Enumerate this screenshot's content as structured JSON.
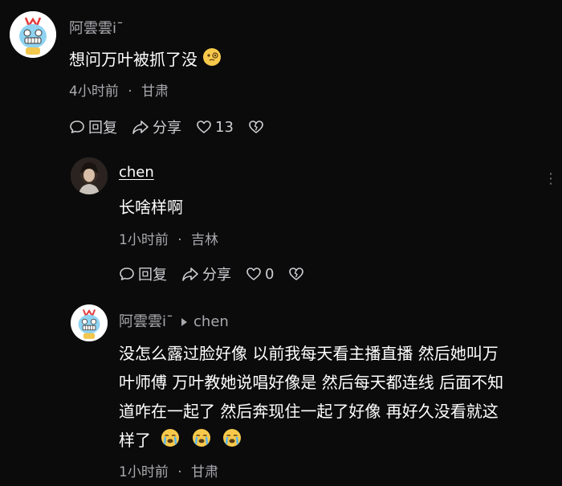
{
  "comments": [
    {
      "username": "阿雲雲i¯",
      "text": "想问万叶被抓了没",
      "emoji": "face-with-monocle",
      "time": "4小时前",
      "location": "甘肃",
      "reply_label": "回复",
      "share_label": "分享",
      "likes": "13"
    },
    {
      "username": "chen",
      "text": "长啥样啊",
      "time": "1小时前",
      "location": "吉林",
      "reply_label": "回复",
      "share_label": "分享",
      "likes": "0"
    },
    {
      "username": "阿雲雲i¯",
      "reply_to": "chen",
      "lines": [
        "没怎么露过脸好像 以前我每天看主播直播 然后她叫万",
        "叶师傅 万叶教她说唱好像是 然后每天都连线 后面不知",
        "道咋在一起了 然后奔现住一起了好像 再好久没看就这",
        "样了"
      ],
      "emoji": "loudly-crying-face",
      "time": "1小时前",
      "location": "甘肃"
    }
  ],
  "more_icon": "more-dots-icon",
  "separator": "·",
  "colors": {
    "background": "#0b0b0c",
    "meta": "#a9a9ae",
    "text": "#ffffff"
  }
}
